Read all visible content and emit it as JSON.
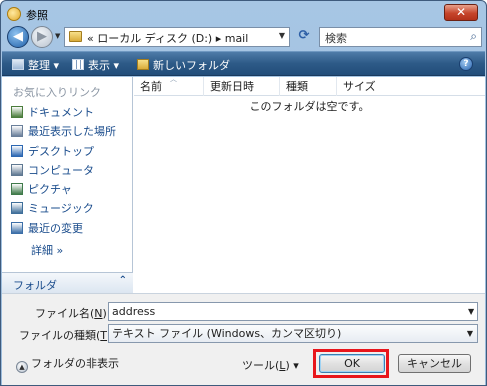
{
  "window": {
    "title": "参照",
    "close_label": "✕"
  },
  "nav": {
    "back_glyph": "◀",
    "forward_glyph": "▶",
    "address_path": "« ローカル ディスク (D:) ▸ mail",
    "search_placeholder": "検索"
  },
  "toolbar": {
    "organize": "整理 ▾",
    "views": "表示 ▾",
    "new_folder": "新しいフォルダ"
  },
  "sidebar": {
    "header": "お気に入りリンク",
    "items": [
      {
        "label": "ドキュメント",
        "icon": "documents-icon",
        "color": "#4b7d3c"
      },
      {
        "label": "最近表示した場所",
        "icon": "recent-places-icon",
        "color": "#6a7f9a"
      },
      {
        "label": "デスクトップ",
        "icon": "desktop-icon",
        "color": "#2d67b2"
      },
      {
        "label": "コンピュータ",
        "icon": "computer-icon",
        "color": "#5f7891"
      },
      {
        "label": "ピクチャ",
        "icon": "pictures-icon",
        "color": "#3f7a4a"
      },
      {
        "label": "ミュージック",
        "icon": "music-icon",
        "color": "#3f6f9a"
      },
      {
        "label": "最近の変更",
        "icon": "recent-changes-icon",
        "color": "#3c6fa8"
      }
    ],
    "more_label": "詳細 »",
    "folders_label": "フォルダ"
  },
  "file_list": {
    "columns": [
      "名前",
      "更新日時",
      "種類",
      "サイズ"
    ],
    "empty_message": "このフォルダは空です。"
  },
  "bottom": {
    "filename_label_prefix": "ファイル名(",
    "filename_accel": "N",
    "filename_label_suffix": "):",
    "filename_value": "address",
    "filetype_label_prefix": "ファイルの種類(",
    "filetype_accel": "T",
    "filetype_label_suffix": "):",
    "filetype_value": "テキスト ファイル (Windows、カンマ区切り)",
    "hide_folders_label": "フォルダの非表示",
    "tools_prefix": "ツール(",
    "tools_accel": "L",
    "tools_suffix": ") ▾",
    "ok_label": "OK",
    "cancel_label": "キャンセル"
  },
  "colors": {
    "highlight": "#e8161c",
    "toolbar": "#2d5a87",
    "link": "#1a4c8c"
  }
}
